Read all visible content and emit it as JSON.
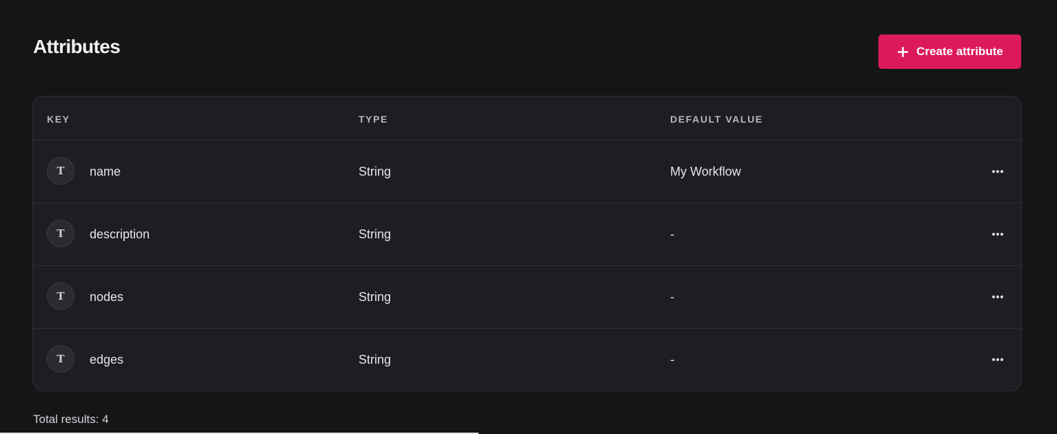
{
  "header": {
    "title": "Attributes",
    "create_button_label": "Create attribute"
  },
  "table": {
    "columns": [
      "KEY",
      "TYPE",
      "DEFAULT VALUE"
    ],
    "rows": [
      {
        "type_icon": "T",
        "key": "name",
        "type": "String",
        "default_value": "My Workflow"
      },
      {
        "type_icon": "T",
        "key": "description",
        "type": "String",
        "default_value": "-"
      },
      {
        "type_icon": "T",
        "key": "nodes",
        "type": "String",
        "default_value": "-"
      },
      {
        "type_icon": "T",
        "key": "edges",
        "type": "String",
        "default_value": "-"
      }
    ]
  },
  "footer": {
    "total_results": "Total results: 4"
  },
  "colors": {
    "background": "#151517",
    "card": "#1e1e22",
    "accent": "#dc1a5a",
    "border": "#2e2e34"
  },
  "icons": {
    "create": "plus-icon",
    "row_type": "text-type-icon",
    "row_actions": "more-horizontal-icon"
  }
}
